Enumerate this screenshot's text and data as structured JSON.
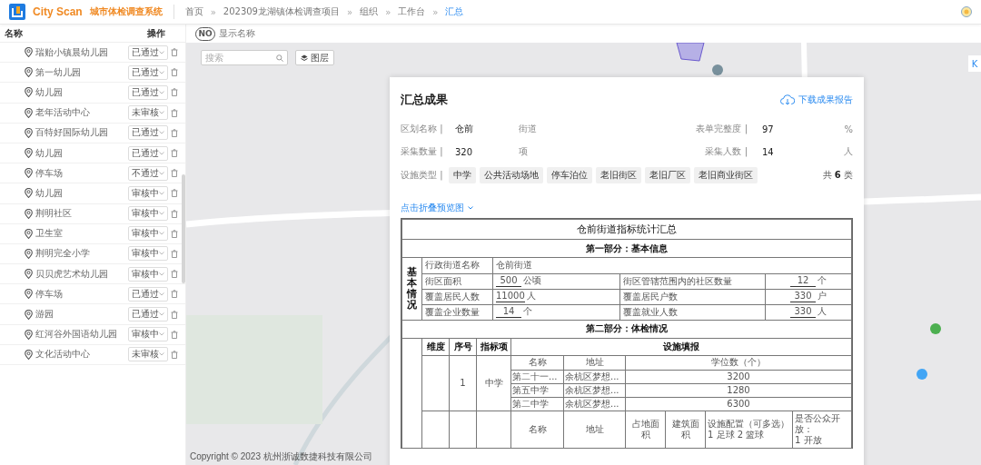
{
  "header": {
    "brand": "City Scan",
    "subtitle": "城市体检调查系统",
    "breadcrumb": [
      {
        "label": "首页",
        "selected": false
      },
      {
        "label": "202309龙湖镇体检调查项目",
        "selected": false
      },
      {
        "label": "组织",
        "selected": false
      },
      {
        "label": "工作台",
        "selected": false
      },
      {
        "label": "汇总",
        "selected": true
      }
    ],
    "separator": "»"
  },
  "sidebar": {
    "columns": [
      "名称",
      "操作"
    ],
    "items": [
      {
        "name": "瑞贻小镇晨幼儿园",
        "status": "已通过"
      },
      {
        "name": "第一幼儿园",
        "status": "已通过"
      },
      {
        "name": "幼儿园",
        "status": "已通过"
      },
      {
        "name": "老年活动中心",
        "status": "未审核"
      },
      {
        "name": "百特好国际幼儿园",
        "status": "已通过"
      },
      {
        "name": "幼儿园",
        "status": "已通过"
      },
      {
        "name": "停车场",
        "status": "不通过"
      },
      {
        "name": "幼儿园",
        "status": "审核中"
      },
      {
        "name": "荆明社区",
        "status": "审核中"
      },
      {
        "name": "卫生室",
        "status": "审核中"
      },
      {
        "name": "荆明完全小学",
        "status": "审核中"
      },
      {
        "name": "贝贝虎艺术幼儿园",
        "status": "审核中"
      },
      {
        "name": "停车场",
        "status": "已通过"
      },
      {
        "name": "游园",
        "status": "已通过"
      },
      {
        "name": "红河谷外国语幼儿园",
        "status": "审核中"
      },
      {
        "name": "文化活动中心",
        "status": "未审核"
      }
    ]
  },
  "map_toolbar": {
    "toggle_text": "NO",
    "on": false,
    "label": "显示名称"
  },
  "map": {
    "search_placeholder": "搜索",
    "layer_button": "图层",
    "side_button": "K",
    "copyright": "Copyright © 2023 杭州浙诚数捷科技有限公司"
  },
  "summary": {
    "title": "汇总成果",
    "download": "下载成果报告",
    "fields": [
      {
        "label": "区划名称",
        "value": "仓前",
        "unit": "街道"
      },
      {
        "label": "表单完整度",
        "value": "97",
        "unit": "%"
      },
      {
        "label": "采集数量",
        "value": "320",
        "unit": "项"
      },
      {
        "label": "采集人数",
        "value": "14",
        "unit": "人"
      }
    ],
    "label_separator": "|",
    "tags_label": "设施类型",
    "tags": [
      "中学",
      "公共活动场地",
      "停车泊位",
      "老旧街区",
      "老旧厂区",
      "老旧商业街区"
    ],
    "total": {
      "prefix": "共",
      "count": "6",
      "suffix": "类"
    },
    "collapse_link": "点击折叠预览图"
  },
  "report": {
    "title": "仓前街道指标统计汇总",
    "part1_title": "第一部分：基本信息",
    "basic_label": "基本情况",
    "name_row": {
      "label": "行政街道名称",
      "value": "仓前街道"
    },
    "basic_rows": [
      {
        "label": "街区面积",
        "value": "500",
        "unit": "公顷",
        "label2": "街区管辖范围内的社区数量",
        "value2": "12",
        "unit2": "个"
      },
      {
        "label": "覆盖居民人数",
        "value": "11000",
        "unit": "人",
        "label2": "覆盖居民户数",
        "value2": "330",
        "unit2": "户"
      },
      {
        "label": "覆盖企业数量",
        "value": "14",
        "unit": "个",
        "label2": "覆盖就业人数",
        "value2": "330",
        "unit2": "人"
      }
    ],
    "part2_title": "第二部分：体检情况",
    "part2_headers": [
      "维度",
      "序号",
      "指标项",
      "设施填报"
    ],
    "item": {
      "no": "1",
      "indicator": "中学",
      "columns": [
        "名称",
        "地址",
        "学位数（个）"
      ],
      "rows": [
        {
          "name": "第二十一...",
          "address": "余杭区梦想...",
          "value": "3200"
        },
        {
          "name": "第五中学",
          "address": "余杭区梦想...",
          "value": "1280"
        },
        {
          "name": "第二中学",
          "address": "余杭区梦想...",
          "value": "6300"
        }
      ]
    },
    "next_columns": [
      "名称",
      "地址",
      "占地面积",
      "建筑面积",
      "设施配置（可多选）",
      "是否公众开放："
    ],
    "next_options": [
      "1 足球 2 篮球",
      "1 开放"
    ]
  }
}
